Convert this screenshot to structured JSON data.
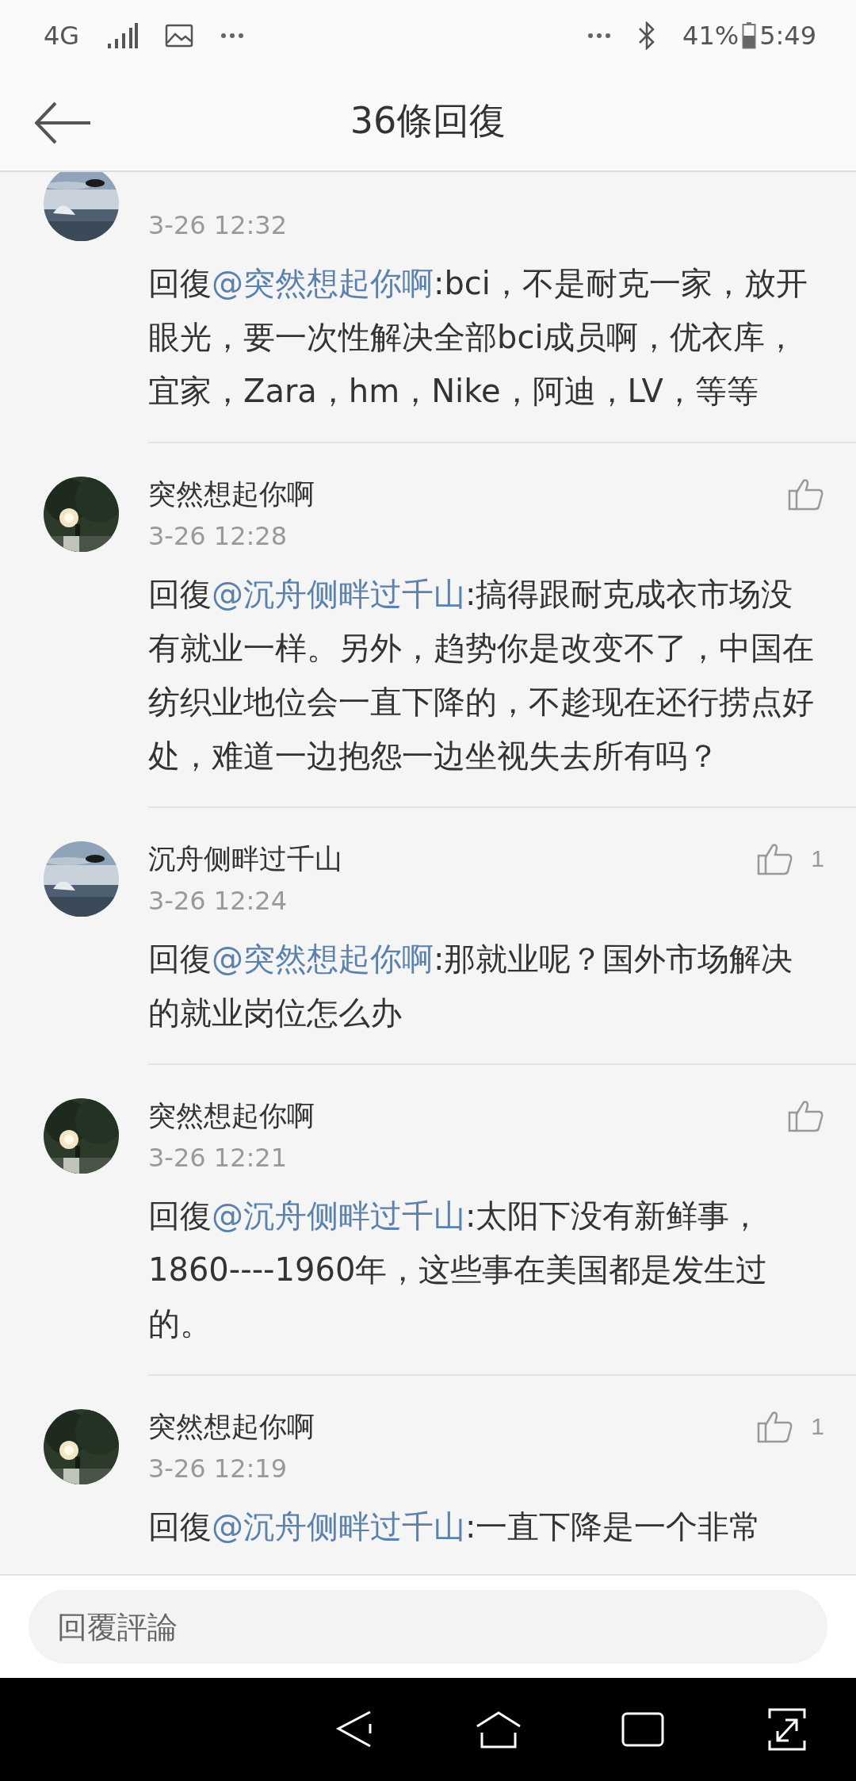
{
  "status_bar": {
    "network": "4G",
    "battery": "41%",
    "time": "5:49"
  },
  "header": {
    "title": "36條回復"
  },
  "comments": [
    {
      "date": "3-26 12:32",
      "reply_prefix": "回復",
      "reply_to": "@突然想起你啊",
      "text": ":bci，不是耐克一家，放开眼光，要一次性解决全部bci成员啊，优衣库，宜家，Zara，hm，Nike，阿迪，LV，等等"
    },
    {
      "name": "突然想起你啊",
      "date": "3-26 12:28",
      "reply_prefix": "回復",
      "reply_to": "@沉舟侧畔过千山",
      "text": ":搞得跟耐克成衣市场没有就业一样。另外，趋势你是改变不了，中国在纺织业地位会一直下降的，不趁现在还行捞点好处，难道一边抱怨一边坐视失去所有吗？"
    },
    {
      "name": "沉舟侧畔过千山",
      "likes": "1",
      "date": "3-26 12:24",
      "reply_prefix": "回復",
      "reply_to": "@突然想起你啊",
      "text": ":那就业呢？国外市场解决的就业岗位怎么办"
    },
    {
      "name": "突然想起你啊",
      "date": "3-26 12:21",
      "reply_prefix": "回復",
      "reply_to": "@沉舟侧畔过千山",
      "text": ":太阳下没有新鲜事，1860----1960年，这些事在美国都是发生过的。"
    },
    {
      "name": "突然想起你啊",
      "likes": "1",
      "date": "3-26 12:19",
      "reply_prefix": "回復",
      "reply_to": "@沉舟侧畔过千山",
      "text": ":一直下降是一个非常"
    }
  ],
  "reply_bar": {
    "placeholder": "回覆評論"
  }
}
